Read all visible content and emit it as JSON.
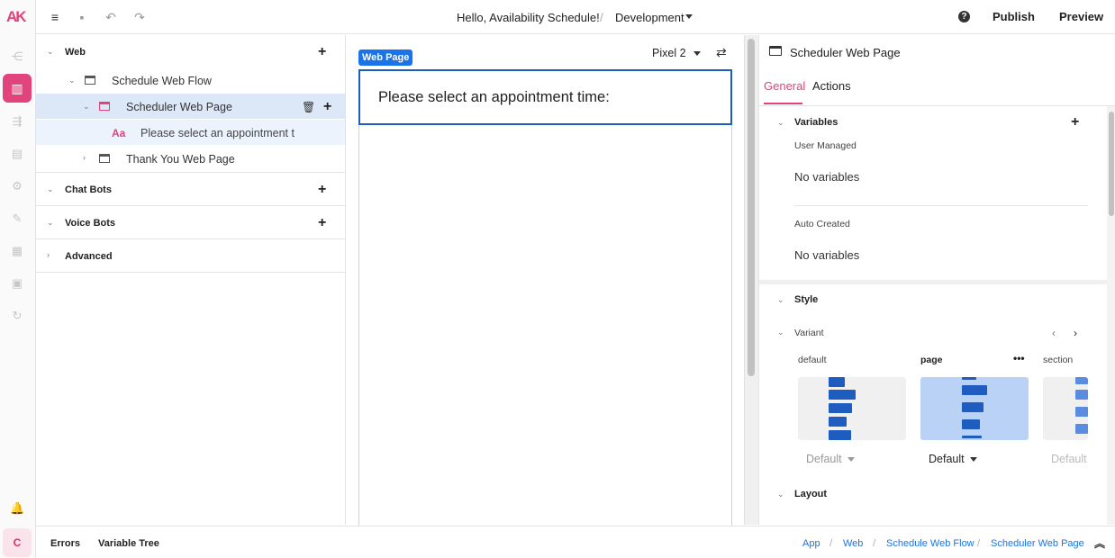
{
  "app": {
    "logo_text": "AK",
    "user_initial": "C"
  },
  "topbar": {
    "title": "Hello, Availability Schedule!",
    "separator": "/",
    "environment": "Development",
    "help_label": "?",
    "publish_label": "Publish",
    "preview_label": "Preview"
  },
  "tree": {
    "web": {
      "label": "Web"
    },
    "flow": {
      "label": "Schedule Web Flow"
    },
    "page1": {
      "label": "Scheduler Web Page"
    },
    "text_node": {
      "label": "Please select an appointment t",
      "icon_text": "Aa"
    },
    "page2": {
      "label": "Thank You Web Page"
    },
    "chat_bots": {
      "label": "Chat Bots"
    },
    "voice_bots": {
      "label": "Voice Bots"
    },
    "advanced": {
      "label": "Advanced"
    }
  },
  "canvas": {
    "badge": "Web Page",
    "device": "Pixel 2",
    "content_text": "Please select an appointment time:"
  },
  "props": {
    "title": "Scheduler Web Page",
    "tabs": [
      {
        "label": "General",
        "active": true
      },
      {
        "label": "Actions",
        "active": false
      }
    ],
    "variables": {
      "heading": "Variables",
      "user_managed_label": "User Managed",
      "user_managed_value": "No variables",
      "auto_created_label": "Auto Created",
      "auto_created_value": "No variables"
    },
    "style": {
      "heading": "Style",
      "variant_label": "Variant",
      "variants": [
        {
          "name": "default",
          "dropdown": "Default",
          "selected": false
        },
        {
          "name": "page",
          "dropdown": "Default",
          "selected": true
        },
        {
          "name": "section",
          "dropdown": "Default",
          "selected": false
        }
      ]
    },
    "layout": {
      "heading": "Layout"
    }
  },
  "bottombar": {
    "tabs": [
      "Errors",
      "Variable Tree"
    ],
    "breadcrumb": [
      "App",
      "Web",
      "Schedule Web Flow",
      "Scheduler Web Page"
    ],
    "separator": "/"
  },
  "colors": {
    "accent": "#e0447a",
    "primary": "#1a73e8",
    "selection": "#dce7f8"
  }
}
